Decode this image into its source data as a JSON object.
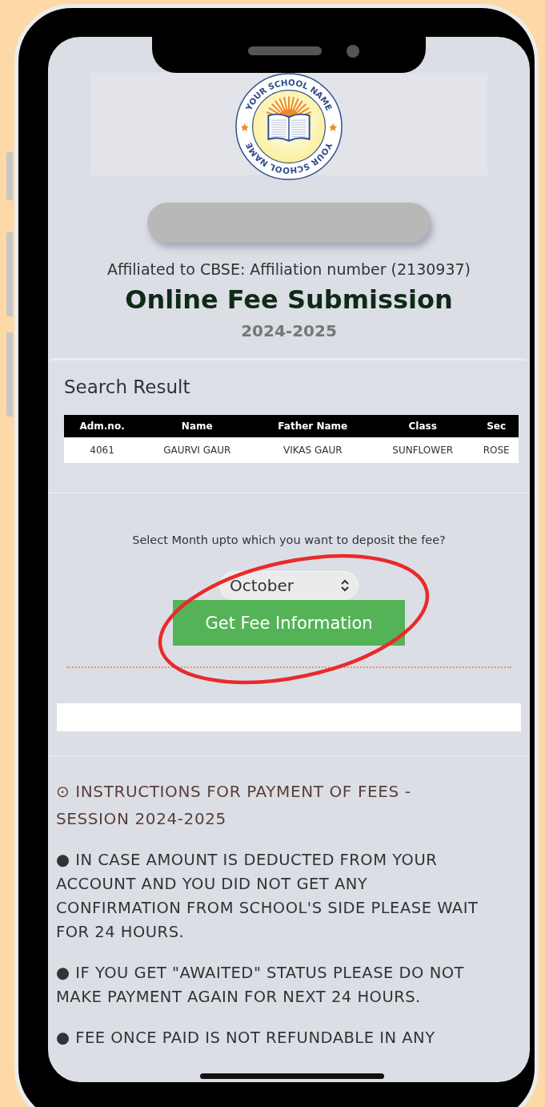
{
  "logo": {
    "top_text": "YOUR SCHOOL NAME",
    "bottom_text": "YOUR SCHOOL NAME"
  },
  "affiliation": "Affiliated to CBSE: Affiliation number (2130937)",
  "title": "Online Fee Submission",
  "session": "2024-2025",
  "search_result": {
    "title": "Search Result",
    "table": {
      "columns": [
        "Adm.no.",
        "Name",
        "Father Name",
        "Class",
        "Sec"
      ],
      "rows": [
        [
          "4061",
          "GAURVI GAUR",
          "VIKAS GAUR",
          "SUNFLOWER",
          "ROSE"
        ]
      ]
    }
  },
  "month_select": {
    "prompt": "Select Month upto which you want to deposit the fee?",
    "value": "October"
  },
  "submit_button": "Get Fee Information",
  "instructions": {
    "heading": "⊙ INSTRUCTIONS FOR PAYMENT OF FEES - SESSION 2024-2025",
    "items": [
      "● IN CASE AMOUNT IS DEDUCTED FROM YOUR ACCOUNT AND YOU DID NOT GET ANY CONFIRMATION FROM SCHOOL'S SIDE PLEASE WAIT FOR 24 HOURS.",
      "● IF YOU GET \"AWAITED\" STATUS PLEASE DO NOT MAKE PAYMENT AGAIN FOR NEXT 24 HOURS.",
      "● FEE ONCE PAID IS NOT REFUNDABLE IN ANY"
    ]
  }
}
